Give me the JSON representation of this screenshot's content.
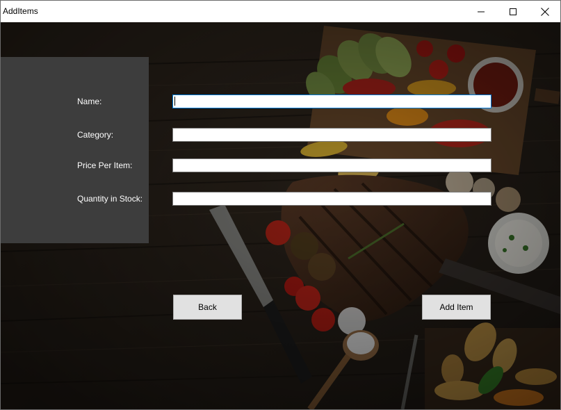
{
  "window": {
    "title": "AddItems",
    "controls": {
      "minimize_icon": "minimize-icon",
      "maximize_icon": "maximize-icon",
      "close_icon": "close-icon"
    }
  },
  "form": {
    "fields": [
      {
        "label": "Name:",
        "value": "",
        "focused": true
      },
      {
        "label": "Category:",
        "value": ""
      },
      {
        "label": "Price Per Item:",
        "value": ""
      },
      {
        "label": "Quantity in Stock:",
        "value": ""
      }
    ],
    "back_label": "Back",
    "add_label": "Add Item"
  },
  "colors": {
    "panel": "#3d3d3d",
    "button_face": "#e1e1e1",
    "focus_border": "#0078d7"
  }
}
